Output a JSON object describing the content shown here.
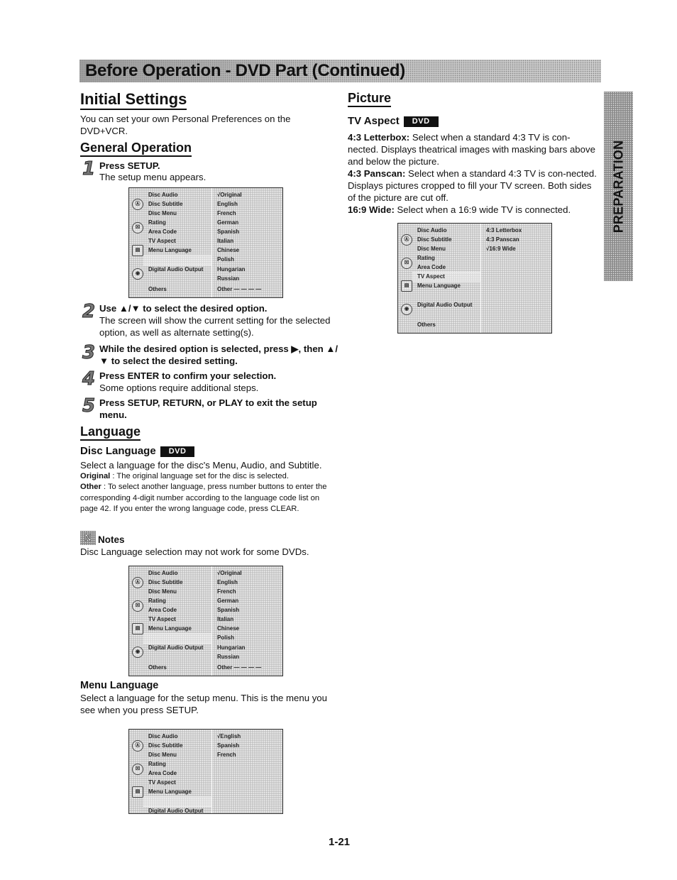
{
  "banner": {
    "title": "Before Operation - DVD Part (Continued)"
  },
  "side_tab": {
    "label": "PREPARATION"
  },
  "left": {
    "initial_settings": {
      "title": "Initial Settings",
      "intro": "You can set your own Personal Preferences on the DVD+VCR."
    },
    "general_operation": {
      "title": "General Operation",
      "steps": [
        {
          "num": "1",
          "title": "Press SETUP.",
          "text": "The setup menu appears."
        },
        {
          "num": "2",
          "title": "Use ▲/▼ to select the desired option.",
          "text": "The screen will show the current setting for the selected option, as well as alternate setting(s)."
        },
        {
          "num": "3",
          "title": "While the desired option is selected, press ▶, then ▲/▼ to select the desired setting.",
          "text": ""
        },
        {
          "num": "4",
          "title": "Press ENTER to confirm your selection.",
          "text": "Some options require additional steps."
        },
        {
          "num": "5",
          "title": "Press SETUP, RETURN, or PLAY to exit the setup menu.",
          "text": ""
        }
      ]
    },
    "language": {
      "title": "Language",
      "disc_language": {
        "title": "Disc Language",
        "badge": "DVD",
        "desc": "Select a language for the disc's Menu, Audio, and Subtitle.",
        "original_label": "Original",
        "original_text": " : The original language set for the disc is selected.",
        "other_label": "Other",
        "other_text": " : To select another language, press number buttons to enter the corresponding 4-digit number according to the language code list on page 42. If you enter the wrong language code, press CLEAR."
      },
      "notes": {
        "icon": "N",
        "title": "Notes",
        "text": "Disc Language selection may not work for some DVDs."
      },
      "menu_language": {
        "title": "Menu Language",
        "desc": "Select a language for the setup menu. This is the menu you see when you press SETUP."
      }
    }
  },
  "right": {
    "picture": {
      "title": "Picture",
      "tv_aspect": {
        "title": "TV Aspect",
        "badge": "DVD",
        "options": [
          {
            "label": "4:3 Letterbox:",
            "text": " Select when a standard 4:3 TV is con-nected. Displays theatrical images with masking bars above and below the picture."
          },
          {
            "label": "4:3 Panscan:",
            "text": " Select when a standard 4:3 TV is con-nected. Displays pictures cropped to fill your TV screen. Both sides of the picture are cut off."
          },
          {
            "label": "16:9 Wide:",
            "text": " Select when a 16:9 wide TV is connected."
          }
        ]
      }
    }
  },
  "osd_menu_items": [
    "Disc Audio",
    "Disc Subtitle",
    "Disc Menu",
    "Rating",
    "Area Code",
    "TV Aspect",
    "Menu Language",
    "Digital Audio Output",
    "Others"
  ],
  "osd_icons": [
    "disc-language-icon",
    "rating-lock-icon",
    "tv-menu-icon",
    "audio-output-icon"
  ],
  "osd_screens": {
    "setup_general": {
      "values": [
        "√Original",
        "English",
        "French",
        "German",
        "Spanish",
        "Italian",
        "Chinese",
        "Polish",
        "Hungarian",
        "Russian",
        "Other — — — —"
      ]
    },
    "tv_aspect": {
      "values": [
        "4:3 Letterbox",
        "4:3 Panscan",
        "√16:9 Wide"
      ]
    },
    "disc_language": {
      "values": [
        "√Original",
        "English",
        "French",
        "German",
        "Spanish",
        "Italian",
        "Chinese",
        "Polish",
        "Hungarian",
        "Russian",
        "Other — — — —"
      ]
    },
    "menu_language": {
      "values": [
        "√English",
        "Spanish",
        "French"
      ],
      "partial_item": "Digital Audio Output"
    }
  },
  "page_number": "1-21"
}
